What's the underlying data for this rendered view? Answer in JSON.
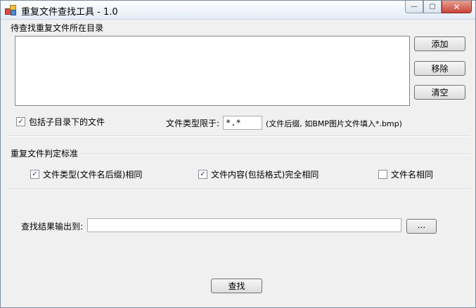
{
  "window": {
    "title": "重复文件查找工具 - 1.0",
    "caption": {
      "minimize": "—",
      "maximize": "▢",
      "close": "✕"
    }
  },
  "dir_section": {
    "label": "待查找重复文件所在目录",
    "buttons": {
      "add": "添加",
      "remove": "移除",
      "clear": "清空"
    }
  },
  "options": {
    "include_subdirs": {
      "label": "包括子目录下的文件",
      "checked": true
    },
    "filetype_label": "文件类型限于:",
    "filetype_value": "*.*",
    "filetype_hint": "(文件后缀, 如BMP图片文件填入*.bmp)"
  },
  "criteria": {
    "label": "重复文件判定标准",
    "same_type": {
      "label": "文件类型(文件名后缀)相同",
      "checked": true
    },
    "same_content": {
      "label": "文件内容(包括格式)完全相同",
      "checked": true
    },
    "same_name": {
      "label": "文件名相同",
      "checked": false
    }
  },
  "output": {
    "label": "查找结果输出到:",
    "value": "",
    "browse": "..."
  },
  "search_button": "查找",
  "check_mark": "✓"
}
